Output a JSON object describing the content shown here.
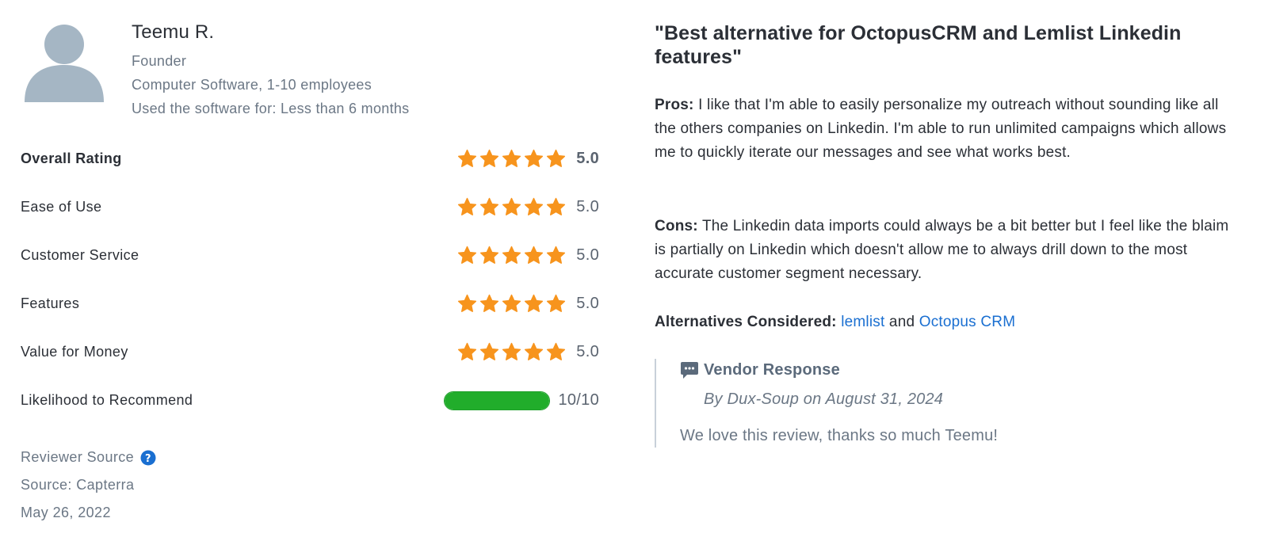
{
  "reviewer": {
    "name": "Teemu R.",
    "role": "Founder",
    "company": "Computer Software, 1-10 employees",
    "usage": "Used the software for: Less than 6 months",
    "avatar_icon": "user-silhouette-icon"
  },
  "ratings": [
    {
      "label": "Overall Rating",
      "value": "5.0",
      "stars": 5
    },
    {
      "label": "Ease of Use",
      "value": "5.0",
      "stars": 5
    },
    {
      "label": "Customer Service",
      "value": "5.0",
      "stars": 5
    },
    {
      "label": "Features",
      "value": "5.0",
      "stars": 5
    },
    {
      "label": "Value for Money",
      "value": "5.0",
      "stars": 5
    }
  ],
  "recommend": {
    "label": "Likelihood to Recommend",
    "value": "10/10",
    "fraction": 1.0
  },
  "source": {
    "reviewer_source_label": "Reviewer Source",
    "source_text": "Source: Capterra",
    "date": "May 26, 2022"
  },
  "review": {
    "title": "\"Best alternative for OctopusCRM and Lemlist Linkedin features\"",
    "pros_label": "Pros:",
    "pros_text": "I like that I'm able to easily personalize my outreach without sounding like all the others companies on Linkedin. I'm able to run unlimited campaigns which allows me to quickly iterate our messages and see what works best.",
    "cons_label": "Cons:",
    "cons_text": "The Linkedin data imports could always be a bit better but I feel like the blaim is partially on Linkedin which doesn't allow me to always drill down to the most accurate customer segment necessary.",
    "alternatives_label": "Alternatives Considered:",
    "alternatives": [
      "lemlist",
      "Octopus CRM"
    ],
    "alternatives_joiner": "and"
  },
  "vendor_response": {
    "title": "Vendor Response",
    "by": "By Dux-Soup on August 31, 2024",
    "message": "We love this review, thanks so much Teemu!"
  },
  "colors": {
    "star": "#f7941d",
    "recommend_fill": "#21ad2b",
    "link": "#1a6fd1",
    "avatar": "#a5b6c4",
    "help_icon": "#1a6fd1"
  }
}
